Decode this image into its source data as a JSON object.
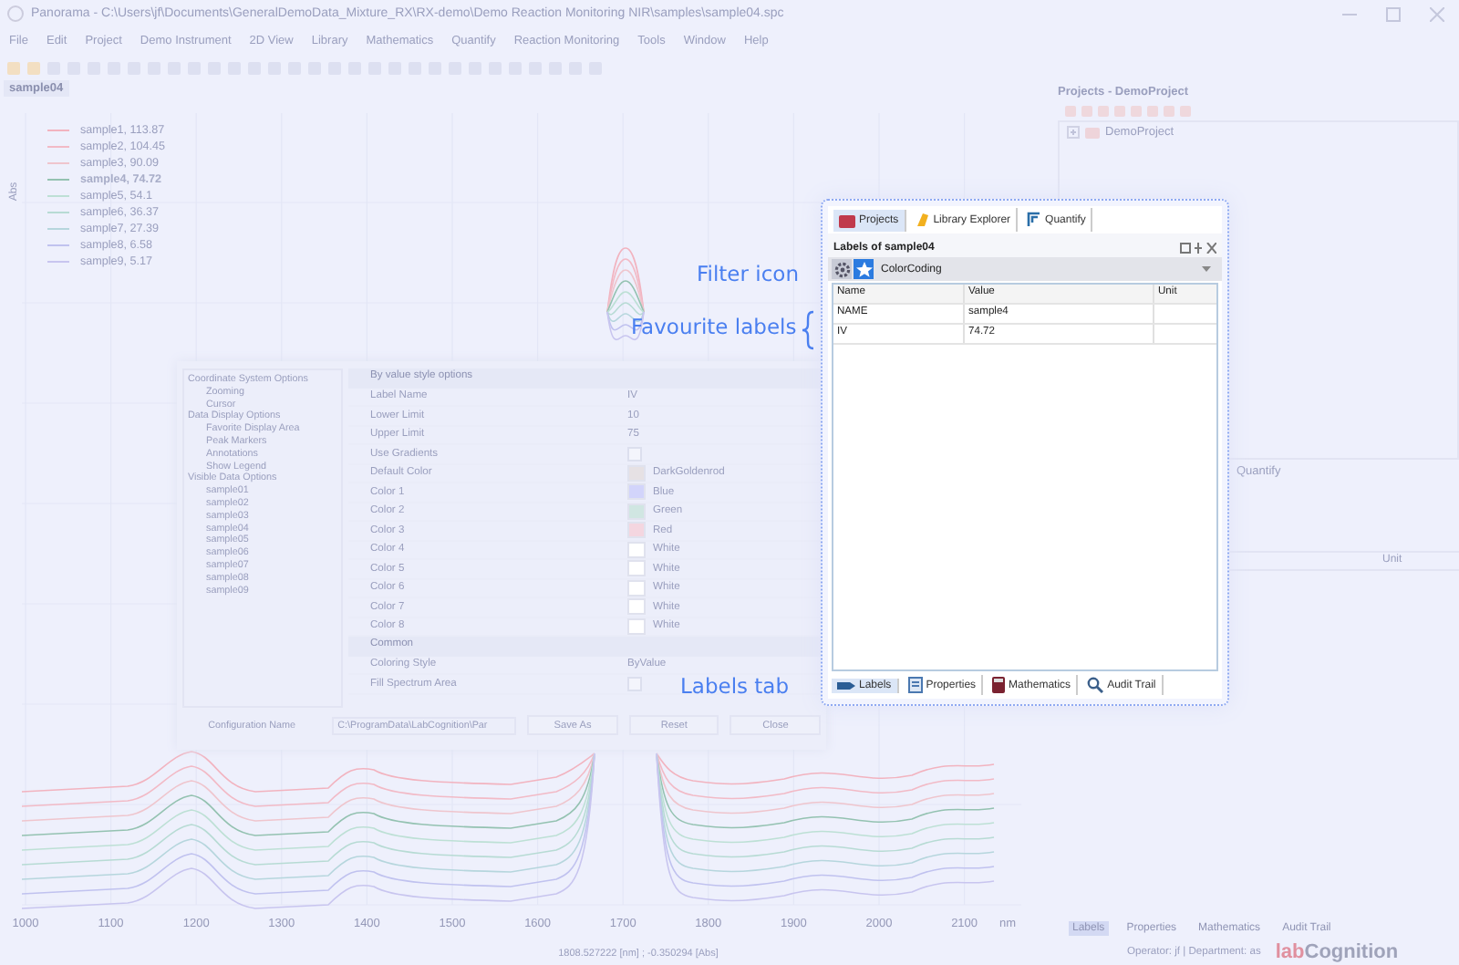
{
  "window": {
    "title": "Panorama - C:\\Users\\jf\\Documents\\GeneralDemoData_Mixture_RX\\RX-demo\\Demo Reaction Monitoring NIR\\samples\\sample04.spc"
  },
  "menu": [
    "File",
    "Edit",
    "Project",
    "Demo Instrument",
    "2D View",
    "Library",
    "Mathematics",
    "Quantify",
    "Reaction Monitoring",
    "Tools",
    "Window",
    "Help"
  ],
  "document_tab": {
    "label": "sample04"
  },
  "plot": {
    "ylabel": "Abs",
    "xunit": "nm",
    "xticks": [
      "1000",
      "1100",
      "1200",
      "1300",
      "1400",
      "1500",
      "1600",
      "1700",
      "1800",
      "1900",
      "2000",
      "2100"
    ],
    "legend": [
      {
        "label": "sample1, 113.87",
        "color": "#f2b3bf",
        "selected": false
      },
      {
        "label": "sample2, 104.45",
        "color": "#f2bac6",
        "selected": false
      },
      {
        "label": "sample3, 90.09",
        "color": "#efc5cd",
        "selected": false
      },
      {
        "label": "sample4, 74.72",
        "color": "#94c2b1",
        "selected": true
      },
      {
        "label": "sample5, 54.1",
        "color": "#bde0d5",
        "selected": false
      },
      {
        "label": "sample6, 36.37",
        "color": "#b7dbd4",
        "selected": false
      },
      {
        "label": "sample7, 27.39",
        "color": "#b6d6dd",
        "selected": false
      },
      {
        "label": "sample8, 6.58",
        "color": "#c0c2ef",
        "selected": false
      },
      {
        "label": "sample9, 5.17",
        "color": "#c8c5ef",
        "selected": false
      }
    ]
  },
  "cursor_readout": "1808.527222 [nm] ; -0.350294 [Abs]",
  "projects_panel": {
    "title": "Projects - DemoProject",
    "tree": [
      {
        "label": "DemoProject",
        "expanded": false
      }
    ]
  },
  "background_labels_panel": {
    "tab": "Quantify",
    "column": "Unit",
    "bottom_tabs": [
      {
        "label": "Labels",
        "selected": true
      },
      {
        "label": "Properties",
        "selected": false
      },
      {
        "label": "Mathematics",
        "selected": false
      },
      {
        "label": "Audit Trail",
        "selected": false
      }
    ]
  },
  "status_bar": {
    "operator": "Operator: jf | Department: as",
    "logo_prefix": "lab",
    "logo_name": "Cognition"
  },
  "options_dialog": {
    "tree": [
      {
        "label": "Coordinate System Options",
        "children": [
          {
            "label": "Zooming"
          },
          {
            "label": "Cursor"
          }
        ]
      },
      {
        "label": "Data Display Options",
        "children": [
          {
            "label": "Favorite Display Area"
          },
          {
            "label": "Peak Markers"
          },
          {
            "label": "Annotations"
          },
          {
            "label": "Show Legend"
          }
        ]
      },
      {
        "label": "Visible Data Options",
        "children": [
          {
            "label": "sample01"
          },
          {
            "label": "sample02"
          },
          {
            "label": "sample03"
          },
          {
            "label": "sample04"
          },
          {
            "label": "sample05"
          },
          {
            "label": "sample06"
          },
          {
            "label": "sample07"
          },
          {
            "label": "sample08"
          },
          {
            "label": "sample09"
          }
        ]
      }
    ],
    "categories": [
      {
        "title": "By value style options",
        "rows": [
          {
            "kind": "text",
            "name": "Label Name",
            "value": "IV"
          },
          {
            "kind": "text",
            "name": "Lower Limit",
            "value": "10"
          },
          {
            "kind": "text",
            "name": "Upper Limit",
            "value": "75"
          },
          {
            "kind": "checkbox",
            "name": "Use Gradients",
            "checked": false
          },
          {
            "kind": "color",
            "name": "Default Color",
            "value": "DarkGoldenrod",
            "color": "#e6e1e4"
          },
          {
            "kind": "color",
            "name": "Color 1",
            "value": "Blue",
            "color": "#d2d4fb"
          },
          {
            "kind": "color",
            "name": "Color 2",
            "value": "Green",
            "color": "#d0e6e2"
          },
          {
            "kind": "color",
            "name": "Color 3",
            "value": "Red",
            "color": "#f4d6e0"
          },
          {
            "kind": "color",
            "name": "Color 4",
            "value": "White",
            "color": "#ffffff"
          },
          {
            "kind": "color",
            "name": "Color 5",
            "value": "White",
            "color": "#ffffff"
          },
          {
            "kind": "color",
            "name": "Color 6",
            "value": "White",
            "color": "#ffffff"
          },
          {
            "kind": "color",
            "name": "Color 7",
            "value": "White",
            "color": "#ffffff"
          },
          {
            "kind": "color",
            "name": "Color 8",
            "value": "White",
            "color": "#ffffff"
          }
        ]
      },
      {
        "title": "Common",
        "rows": [
          {
            "kind": "text",
            "name": "Coloring Style",
            "value": "ByValue"
          },
          {
            "kind": "checkbox",
            "name": "Fill Spectrum Area",
            "checked": false
          }
        ]
      }
    ],
    "configuration_label": "Configuration Name",
    "configuration_path": "C:\\ProgramData\\LabCognition\\Par",
    "buttons": [
      "Save As",
      "Reset",
      "Close"
    ]
  },
  "labels_panel": {
    "tabs": [
      {
        "label": "Projects",
        "selected": true
      },
      {
        "label": "Library Explorer",
        "selected": false
      },
      {
        "label": "Quantify",
        "selected": false
      }
    ],
    "title": "Labels of sample04",
    "filter": "ColorCoding",
    "columns": [
      "Name",
      "Value",
      "Unit"
    ],
    "rows": [
      [
        "NAME",
        "sample4",
        ""
      ],
      [
        "IV",
        "74.72",
        ""
      ]
    ],
    "bottom_tabs": [
      {
        "label": "Labels",
        "selected": true
      },
      {
        "label": "Properties",
        "selected": false
      },
      {
        "label": "Mathematics",
        "selected": false
      },
      {
        "label": "Audit Trail",
        "selected": false
      }
    ]
  },
  "annotations": [
    {
      "kind": "label",
      "text": "Filter icon"
    },
    {
      "kind": "brace",
      "text": "Favourite labels"
    },
    {
      "kind": "label",
      "text": "Labels tab"
    }
  ]
}
